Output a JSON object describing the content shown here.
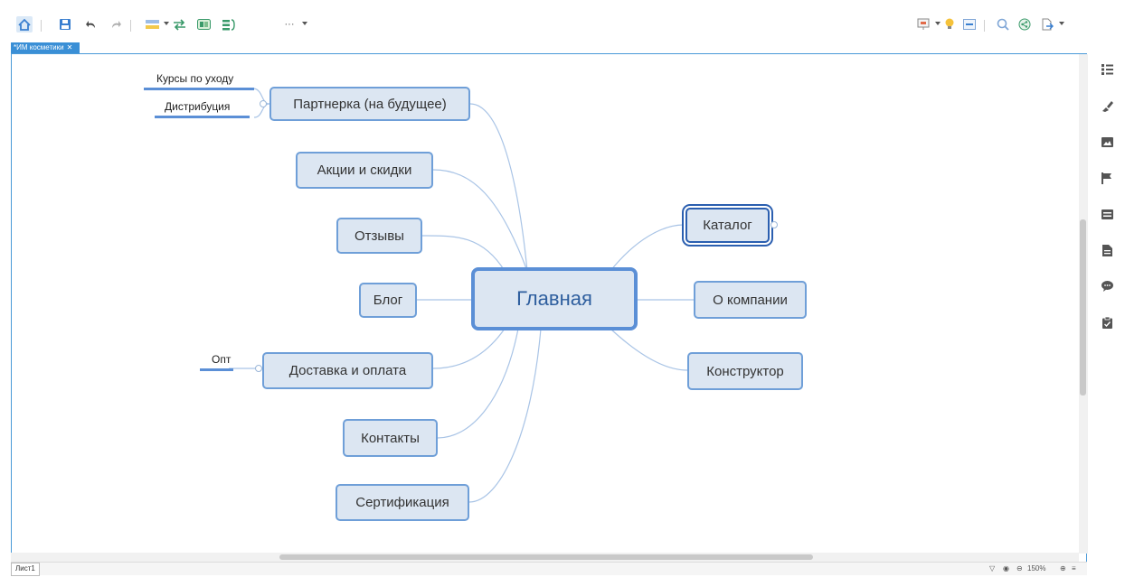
{
  "toolbar": {
    "icons": [
      "home-icon",
      "save-icon",
      "undo-icon",
      "redo-icon",
      "topic-icon",
      "relationship-icon",
      "boundary-icon",
      "summary-icon",
      "more-icon"
    ],
    "right_icons": [
      "presentation-icon",
      "brainstorm-icon",
      "outline-icon",
      "search-icon",
      "share-icon",
      "export-icon"
    ],
    "more_label": "···"
  },
  "document_tab": {
    "title": "*ИМ косметики",
    "close": "✕"
  },
  "mindmap": {
    "central": "Главная",
    "left_topics": [
      "Партнерка (на будущее)",
      "Акции и скидки",
      "Отзывы",
      "Блог",
      "Доставка и оплата",
      "Контакты",
      "Сертификация"
    ],
    "right_topics": [
      "Каталог",
      "О компании",
      "Конструктор"
    ],
    "subtopics": {
      "partnerka": [
        "Курсы по уходу",
        "Дистрибуция"
      ],
      "dostavka": [
        "Опт"
      ]
    },
    "selected_topic": "Каталог"
  },
  "statusbar": {
    "sheet": "Лист1",
    "zoom": "150%"
  },
  "sidebar": {
    "icons": [
      "outline-panel-icon",
      "format-brush-icon",
      "image-icon",
      "marker-flag-icon",
      "text-style-icon",
      "notes-icon",
      "comments-icon",
      "task-icon"
    ]
  },
  "colors": {
    "accent": "#5b8fd6",
    "node_fill": "#dce6f2",
    "line": "#a9c4e6"
  }
}
